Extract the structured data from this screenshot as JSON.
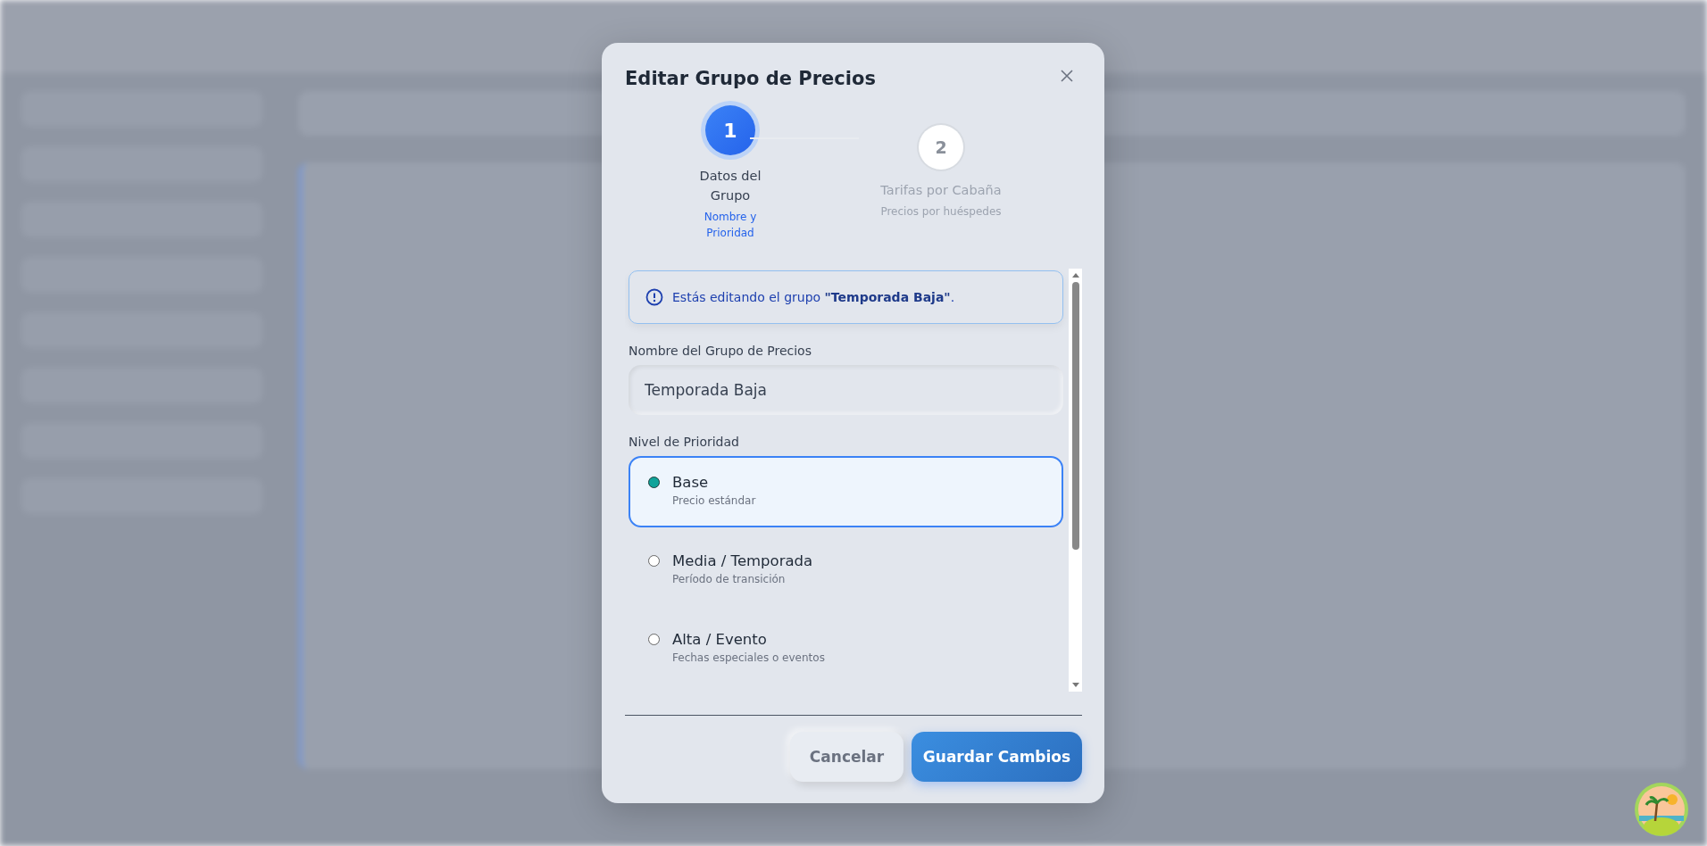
{
  "dialog": {
    "title": "Editar Grupo de Precios",
    "steps": [
      {
        "number": "1",
        "label": "Datos del Grupo",
        "sublabel": "Nombre y Prioridad",
        "selected": true
      },
      {
        "number": "2",
        "label": "Tarifas por Cabaña",
        "sublabel": "Precios por huéspedes",
        "selected": false
      }
    ],
    "notice": "Estás editando el grupo **\"Temporada Baja\"**.",
    "name_field": {
      "label": "Nombre del Grupo de Precios",
      "value": "Temporada Baja"
    },
    "priority": {
      "label": "Nivel de Prioridad",
      "options": [
        {
          "title": "Base",
          "description": "Precio estándar",
          "selected": true
        },
        {
          "title": "Media / Temporada",
          "description": "Período de transición",
          "selected": false
        },
        {
          "title": "Alta / Evento",
          "description": "Fechas especiales o eventos",
          "selected": false
        }
      ]
    },
    "buttons": [
      {
        "label": "Cancelar",
        "kind": "secondary"
      },
      {
        "label": "Guardar Cambios",
        "kind": "primary"
      }
    ]
  }
}
